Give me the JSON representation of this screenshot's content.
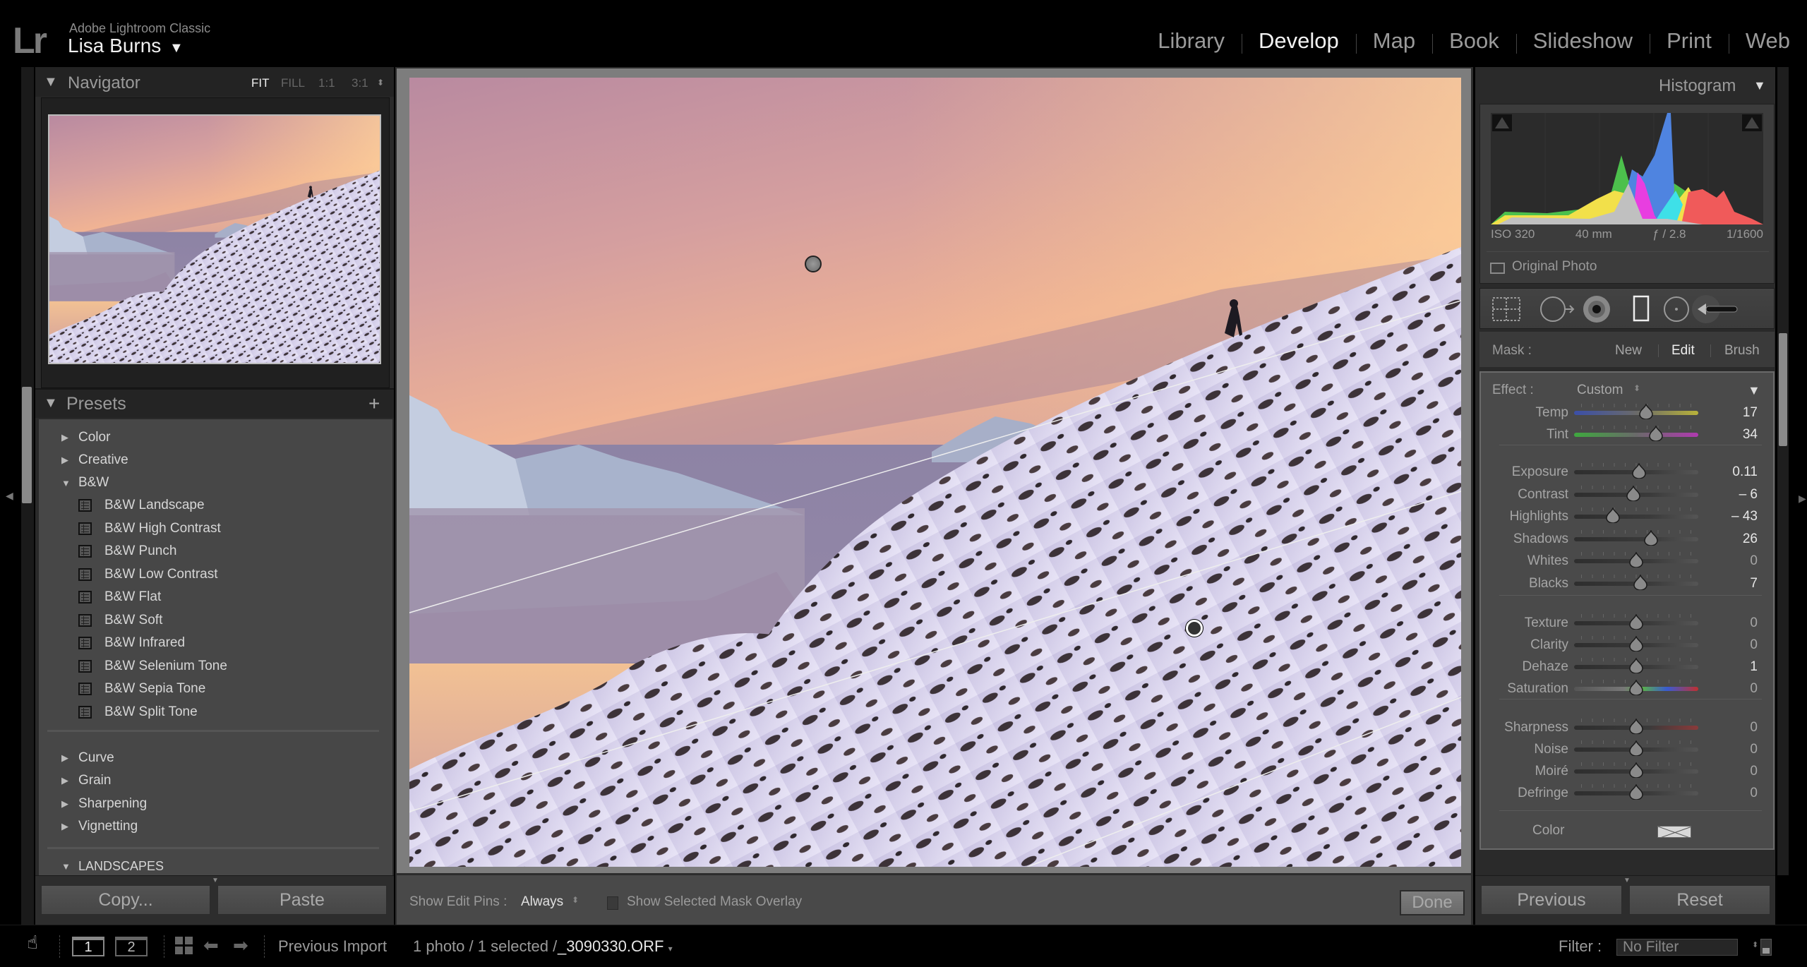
{
  "app": {
    "product": "Adobe Lightroom Classic",
    "logo": "Lr",
    "user": "Lisa Burns",
    "user_menu_icon": "triangle-down-icon"
  },
  "modules": [
    {
      "label": "Library",
      "active": false
    },
    {
      "label": "Develop",
      "active": true
    },
    {
      "label": "Map",
      "active": false
    },
    {
      "label": "Book",
      "active": false
    },
    {
      "label": "Slideshow",
      "active": false
    },
    {
      "label": "Print",
      "active": false
    },
    {
      "label": "Web",
      "active": false
    }
  ],
  "navigator": {
    "title": "Navigator",
    "zoom_options": [
      "FIT",
      "FILL",
      "1:1",
      "3:1"
    ],
    "active_zoom": "FIT"
  },
  "presets": {
    "title": "Presets",
    "add_icon": "plus-icon",
    "groups_top": [
      {
        "label": "Color",
        "expanded": false
      },
      {
        "label": "Creative",
        "expanded": false
      },
      {
        "label": "B&W",
        "expanded": true
      }
    ],
    "bw_items": [
      "B&W Landscape",
      "B&W High Contrast",
      "B&W Punch",
      "B&W Low Contrast",
      "B&W Flat",
      "B&W Soft",
      "B&W Infrared",
      "B&W Selenium Tone",
      "B&W Sepia Tone",
      "B&W Split Tone"
    ],
    "groups_mid": [
      {
        "label": "Curve",
        "expanded": false
      },
      {
        "label": "Grain",
        "expanded": false
      },
      {
        "label": "Sharpening",
        "expanded": false
      },
      {
        "label": "Vignetting",
        "expanded": false
      }
    ],
    "groups_bottom": [
      {
        "label": "LANDSCAPES",
        "expanded": true
      }
    ]
  },
  "left_buttons": {
    "copy": "Copy...",
    "paste": "Paste"
  },
  "toolbar": {
    "show_edit_pins_label": "Show Edit Pins :",
    "show_edit_pins_value": "Always",
    "overlay_label": "Show Selected Mask Overlay",
    "overlay_checked": false,
    "done_label": "Done"
  },
  "histogram": {
    "title": "Histogram",
    "exif": {
      "iso": "ISO 320",
      "focal": "40 mm",
      "aperture": "ƒ / 2.8",
      "shutter": "1/1600"
    },
    "original_photo_label": "Original Photo",
    "original_photo_checked": false,
    "colors": {
      "red": "#f05a5a",
      "green": "#4cc04c",
      "blue": "#4f84e0",
      "yellow": "#f2e04a",
      "cyan": "#3ee0e8",
      "magenta": "#e83ee0",
      "gray": "#c0c0c0"
    }
  },
  "tools": [
    {
      "name": "crop-overlay-icon"
    },
    {
      "name": "spot-removal-icon"
    },
    {
      "name": "red-eye-icon"
    },
    {
      "name": "graduated-filter-icon"
    },
    {
      "name": "radial-filter-icon"
    },
    {
      "name": "adjustment-brush-icon"
    }
  ],
  "mask": {
    "label": "Mask :",
    "options": [
      "New",
      "Edit",
      "Brush"
    ],
    "active": "Edit"
  },
  "effect": {
    "label": "Effect :",
    "value": "Custom"
  },
  "sliders": [
    {
      "group": 0,
      "label": "Temp",
      "value": "17",
      "pos": 0.58,
      "track": "temp",
      "hi": true
    },
    {
      "group": 0,
      "label": "Tint",
      "value": "34",
      "pos": 0.66,
      "track": "tint",
      "hi": true
    },
    {
      "group": 1,
      "label": "Exposure",
      "value": "0.11",
      "pos": 0.52,
      "track": "plain",
      "hi": true
    },
    {
      "group": 1,
      "label": "Contrast",
      "value": "– 6",
      "pos": 0.48,
      "track": "plain",
      "hi": true
    },
    {
      "group": 1,
      "label": "Highlights",
      "value": "– 43",
      "pos": 0.31,
      "track": "plain",
      "hi": true
    },
    {
      "group": 1,
      "label": "Shadows",
      "value": "26",
      "pos": 0.62,
      "track": "plain",
      "hi": true
    },
    {
      "group": 1,
      "label": "Whites",
      "value": "0",
      "pos": 0.5,
      "track": "plain",
      "hi": false
    },
    {
      "group": 1,
      "label": "Blacks",
      "value": "7",
      "pos": 0.535,
      "track": "plain",
      "hi": true
    },
    {
      "group": 2,
      "label": "Texture",
      "value": "0",
      "pos": 0.5,
      "track": "plain",
      "hi": false
    },
    {
      "group": 2,
      "label": "Clarity",
      "value": "0",
      "pos": 0.5,
      "track": "plain",
      "hi": false
    },
    {
      "group": 2,
      "label": "Dehaze",
      "value": "1",
      "pos": 0.5,
      "track": "plain",
      "hi": true
    },
    {
      "group": 2,
      "label": "Saturation",
      "value": "0",
      "pos": 0.5,
      "track": "saturation",
      "hi": false
    },
    {
      "group": 3,
      "label": "Sharpness",
      "value": "0",
      "pos": 0.5,
      "track": "sharpness",
      "hi": false
    },
    {
      "group": 3,
      "label": "Noise",
      "value": "0",
      "pos": 0.5,
      "track": "plain",
      "hi": false
    },
    {
      "group": 3,
      "label": "Moiré",
      "value": "0",
      "pos": 0.5,
      "track": "plain",
      "hi": false
    },
    {
      "group": 3,
      "label": "Defringe",
      "value": "0",
      "pos": 0.5,
      "track": "plain",
      "hi": false
    }
  ],
  "color_label": "Color",
  "right_buttons": {
    "previous": "Previous",
    "reset": "Reset"
  },
  "filmstrip": {
    "window_1": "1",
    "window_2": "2",
    "source": "Previous Import",
    "count": "1 photo / 1 selected /",
    "file": "_3090330.ORF",
    "file_menu": "▾",
    "filter_label": "Filter :",
    "filter_value": "No Filter"
  }
}
